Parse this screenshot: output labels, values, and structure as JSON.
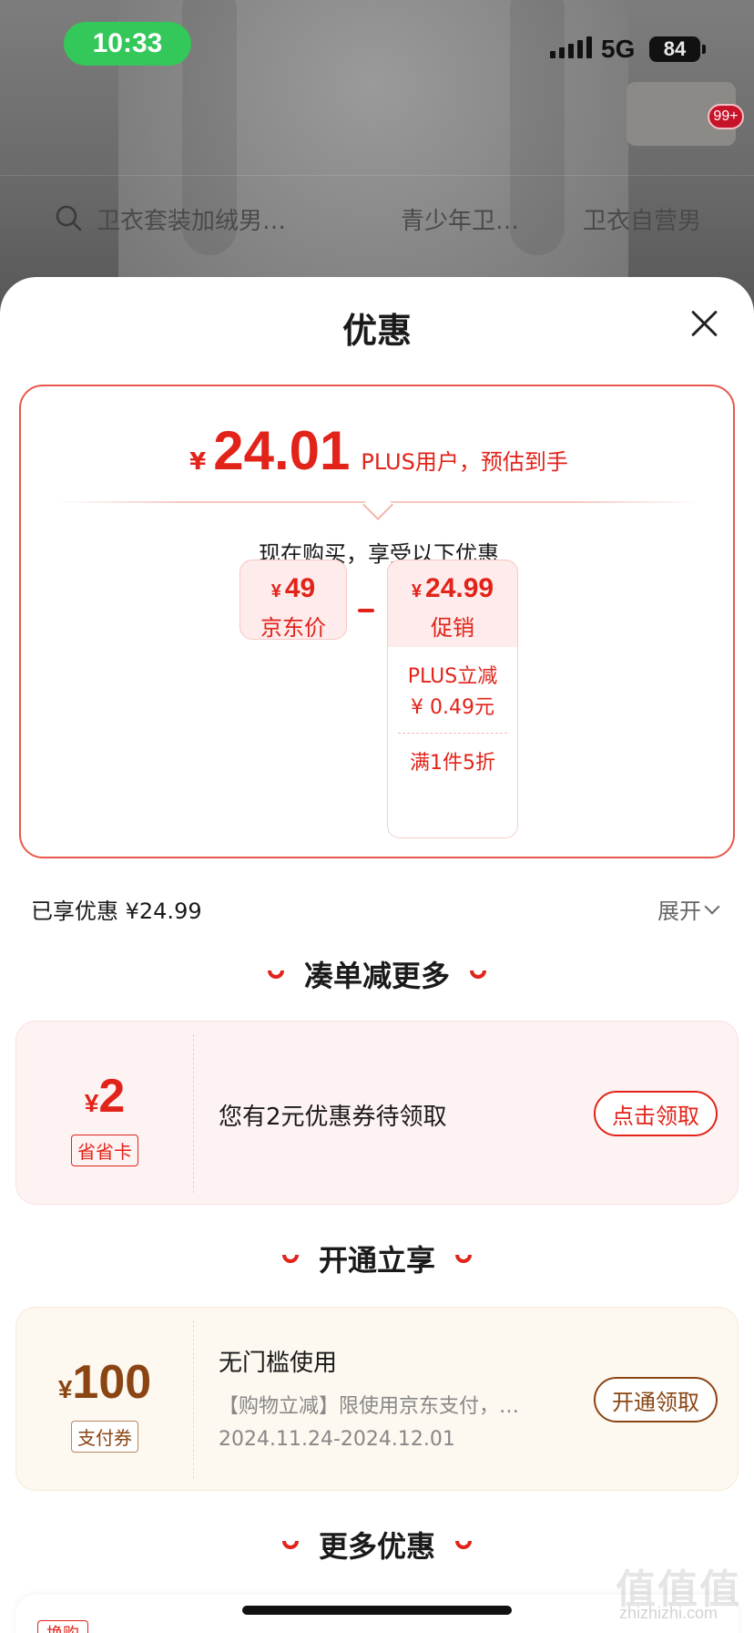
{
  "status_bar": {
    "time": "10:33",
    "network": "5G",
    "battery": "84"
  },
  "background_app": {
    "cart_badge": "99+",
    "search_suggestions": [
      "卫衣套装加绒男…",
      "青少年卫…",
      "卫衣自营男"
    ]
  },
  "sheet": {
    "title": "优惠",
    "price_box": {
      "currency": "¥",
      "final_price": "24.01",
      "final_note": "PLUS用户，预估到手",
      "buy_now_text": "现在购买，享受以下优惠",
      "jd_price": {
        "currency": "¥",
        "value": "49",
        "label": "京东价"
      },
      "promo": {
        "currency": "¥",
        "value": "24.99",
        "label": "促销"
      },
      "promo_details": {
        "plus_line1": "PLUS立减",
        "plus_line2": "¥ 0.49元",
        "discount": "满1件5折"
      }
    },
    "enjoyed": "已享优惠 ¥24.99",
    "expand": "展开",
    "sections": {
      "more_discount": "凑单减更多",
      "open_get": "开通立享",
      "more_offers": "更多优惠"
    },
    "coupon_save": {
      "currency": "¥",
      "amount": "2",
      "tag": "省省卡",
      "text": "您有2元优惠券待领取",
      "button": "点击领取"
    },
    "coupon_pay": {
      "currency": "¥",
      "amount": "100",
      "tag": "支付券",
      "title": "无门槛使用",
      "desc": "【购物立减】限使用京东支付，…",
      "date": "2024.11.24-2024.12.01",
      "button": "开通领取"
    },
    "partial_tag": "换购"
  },
  "watermark": {
    "main": "值值值",
    "sub": "zhizhizhi.com"
  },
  "colors": {
    "accent": "#e2231a",
    "gold": "#8a4513",
    "status_green": "#34c759"
  }
}
